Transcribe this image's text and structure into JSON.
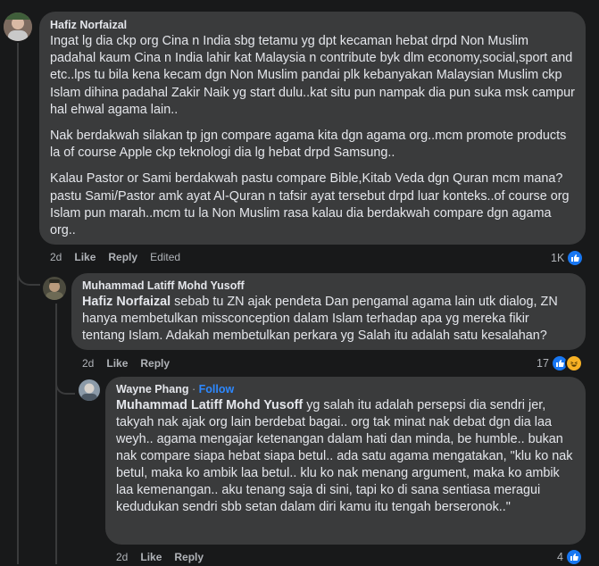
{
  "comments": [
    {
      "author": "Hafiz Norfaizal",
      "paragraphs": [
        "Ingat lg dia ckp org Cina n India sbg tetamu yg dpt kecaman hebat drpd Non Muslim padahal kaum Cina n India lahir kat Malaysia n contribute byk dlm economy,social,sport and etc..lps tu bila kena kecam dgn Non Muslim pandai plk kebanyakan Malaysian Muslim ckp Islam dihina padahal Zakir Naik yg start dulu..kat situ pun nampak dia pun suka msk campur hal ehwal agama lain..",
        "Nak berdakwah silakan tp jgn compare agama kita dgn agama org..mcm promote products la of course Apple ckp teknologi dia lg hebat drpd Samsung..",
        "Kalau Pastor or Sami berdakwah pastu compare Bible,Kitab Veda dgn Quran mcm mana?pastu Sami/Pastor amk ayat Al-Quran n tafsir ayat tersebut drpd luar konteks..of course org Islam pun marah..mcm tu la Non Muslim rasa kalau dia berdakwah compare dgn agama org.."
      ],
      "time": "2d",
      "like_label": "Like",
      "reply_label": "Reply",
      "edited_label": "Edited",
      "reaction_count": "1K"
    },
    {
      "author": "Muhammad Latiff Mohd Yusoff",
      "mention": "Hafiz Norfaizal",
      "text": " sebab tu ZN ajak pendeta Dan pengamal agama lain utk dialog, ZN hanya membetulkan missconception dalam Islam terhadap apa yg mereka fikir tentang Islam. Adakah membetulkan perkara yg Salah itu adalah satu kesalahan?",
      "time": "2d",
      "like_label": "Like",
      "reply_label": "Reply",
      "reaction_count": "17"
    },
    {
      "author": "Wayne Phang",
      "separator": "·",
      "follow_label": "Follow",
      "mention": "Muhammad Latiff Mohd Yusoff",
      "text": " yg salah itu adalah persepsi dia sendri jer, takyah nak ajak org lain berdebat bagai.. org tak minat nak debat dgn dia laa weyh.. agama mengajar ketenangan dalam hati dan minda, be humble.. bukan nak compare siapa hebat siapa betul.. ada satu agama mengatakan, \"klu ko nak betul, maka ko ambik laa betul.. klu ko nak menang argument, maka ko ambik laa kemenangan.. aku tenang saja di sini, tapi ko di sana sentiasa meragui kedudukan sendri sbb setan dalam diri kamu itu tengah berseronok..\"",
      "time": "2d",
      "like_label": "Like",
      "reply_label": "Reply",
      "reaction_count": "4"
    }
  ],
  "colors": {
    "background": "#18191a",
    "bubble": "#3a3b3c",
    "text": "#e4e6eb",
    "secondary": "#b0b3b8",
    "like_blue": "#1877f2",
    "link": "#2d88ff"
  }
}
